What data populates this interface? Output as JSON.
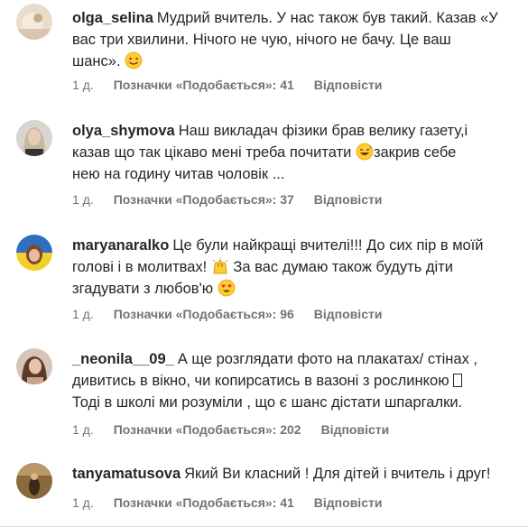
{
  "comments": [
    {
      "username": "olga_selina",
      "lines": [
        "Мудрий вчитель. У нас також був такий. Казав «У",
        "вас три хвилини. Нічого не чую, нічого не бачу. Це ваш",
        "шанс»."
      ],
      "emoji": "smiling-face-icon",
      "time": "1 д.",
      "likes": "Позначки «Подобається»: 41",
      "reply": "Відповісти"
    },
    {
      "username": "olya_shymova",
      "lines": [
        "Наш викладач фізики брав велику газету,і",
        "казав що так цікаво мені треба почитати",
        "нею на годину читав чоловік ..."
      ],
      "line2_tail": "закрив себе",
      "emoji": "grinning-sweat-face-icon",
      "time": "1 д.",
      "likes": "Позначки «Подобається»: 37",
      "reply": "Відповісти"
    },
    {
      "username": "maryanaralko",
      "lines": [
        "Це були найкращі вчителі!!! До сих пір в моїй",
        "голові і в молитвах!",
        "згадувати з любов'ю"
      ],
      "line2_tail": "За вас думаю також будуть діти",
      "emoji": "raising-hands-icon",
      "emoji2": "heart-eyes-face-icon",
      "time": "1 д.",
      "likes": "Позначки «Подобається»: 96",
      "reply": "Відповісти"
    },
    {
      "username": "_neonila__09_",
      "lines": [
        "А ще розглядати фото на плакатах/ стінах ,",
        "дивитись в вікно, чи копирсатись в вазоні з рослинкою",
        "Тоді в школі ми розуміли , що є шанс дістати шпаргалки."
      ],
      "time": "1 д.",
      "likes": "Позначки «Подобається»: 202",
      "reply": "Відповісти"
    },
    {
      "username": "tanyamatusova",
      "lines": [
        "Який Ви класний ! Для дітей і вчитель і друг!"
      ],
      "time": "1 д.",
      "likes": "Позначки «Подобається»: 41",
      "reply": "Відповісти"
    }
  ],
  "colors": {
    "text": "#262626",
    "meta": "#737373",
    "divider": "#dbdbdb"
  }
}
